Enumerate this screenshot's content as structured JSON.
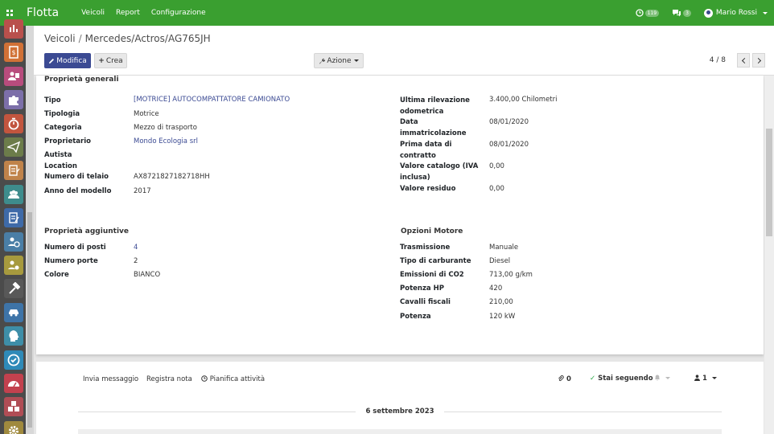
{
  "topbar": {
    "brand": "Flotta",
    "menu": [
      "Veicoli",
      "Report",
      "Configurazione"
    ],
    "activity_count": "119",
    "message_count": "3",
    "user_name": "Mario Rossi"
  },
  "apps_sidebar": {
    "tiles": [
      {
        "icon": "sales-icon",
        "color": "#b9504c"
      },
      {
        "icon": "invoice-icon",
        "color": "#d17136"
      },
      {
        "icon": "contacts-icon",
        "color": "#b84c7d"
      },
      {
        "icon": "puzzle-icon",
        "color": "#7c6fa9"
      },
      {
        "icon": "timer-icon",
        "color": "#c2553e"
      },
      {
        "icon": "paper-plane-icon",
        "color": "#6c7c4a"
      },
      {
        "icon": "survey-icon",
        "color": "#c0834a"
      },
      {
        "icon": "employees-icon",
        "color": "#3e8c8c"
      },
      {
        "icon": "notes-icon",
        "color": "#3e6aa8"
      },
      {
        "icon": "attendance-icon",
        "color": "#4a7ea6"
      },
      {
        "icon": "recruitment-icon",
        "color": "#a79a3e"
      },
      {
        "icon": "hammer-icon",
        "color": "#585858"
      },
      {
        "icon": "car-icon",
        "color": "#3e74a8"
      },
      {
        "icon": "head-icon",
        "color": "#3e8ea8"
      },
      {
        "icon": "check-circle-icon",
        "color": "#2e8ab8"
      },
      {
        "icon": "dashboard-icon",
        "color": "#c3414e"
      },
      {
        "icon": "cubes-icon",
        "color": "#b04d55"
      },
      {
        "icon": "gear-icon",
        "color": "#a08a3e"
      }
    ]
  },
  "breadcrumb": {
    "parent": "Veicoli",
    "current": "Mercedes/Actros/AG765JH"
  },
  "toolbar": {
    "edit_label": "Modifica",
    "create_label": "Crea",
    "action_label": "Azione",
    "pager": "4 / 8"
  },
  "general": {
    "title": "Proprietà generali",
    "left": [
      {
        "label": "Tipo",
        "value": "[MOTRICE] AUTOCOMPATTATORE CAMIONATO",
        "link": true
      },
      {
        "label": "Tipologia",
        "value": "Motrice",
        "link": false
      },
      {
        "label": "Categoria",
        "value": "Mezzo di trasporto",
        "link": false
      },
      {
        "label": "Proprietario",
        "value": "Mondo Ecologia srl",
        "link": true
      },
      {
        "label": "Autista",
        "value": "",
        "link": false
      },
      {
        "label": "Location",
        "value": "",
        "link": false
      },
      {
        "label": "Numero di telaio",
        "value": "AX8721827182718HH",
        "link": false
      },
      {
        "label": "Anno del modello",
        "value": "2017",
        "link": false
      }
    ],
    "right": [
      {
        "label": "Ultima rilevazione odometrica",
        "value": "3.400,00 Chilometri"
      },
      {
        "label": "Data immatricolazione",
        "value": "08/01/2020"
      },
      {
        "label": "Prima data di contratto",
        "value": "08/01/2020"
      },
      {
        "label": "Valore catalogo (IVA inclusa)",
        "value": "0,00"
      },
      {
        "label": "Valore residuo",
        "value": "0,00"
      }
    ]
  },
  "additional": {
    "title": "Proprietà aggiuntive",
    "rows": [
      {
        "label": "Numero di posti",
        "value": "4"
      },
      {
        "label": "Numero porte",
        "value": "2"
      },
      {
        "label": "Colore",
        "value": "BIANCO"
      }
    ]
  },
  "engine": {
    "title": "Opzioni Motore",
    "rows": [
      {
        "label": "Trasmissione",
        "value": "Manuale"
      },
      {
        "label": "Tipo di carburante",
        "value": "Diesel"
      },
      {
        "label": "Emissioni di CO2",
        "value": "713,00 g/km"
      },
      {
        "label": "Potenza HP",
        "value": "420"
      },
      {
        "label": "Cavalli fiscali",
        "value": "210,00"
      },
      {
        "label": "Potenza",
        "value": "120 kW"
      }
    ]
  },
  "chatter": {
    "send_message": "Invia messaggio",
    "log_note": "Registra nota",
    "schedule_activity": "Pianifica attività",
    "attachments": "0",
    "following": "Stai seguendo",
    "followers": "1",
    "date": "6 settembre 2023"
  }
}
